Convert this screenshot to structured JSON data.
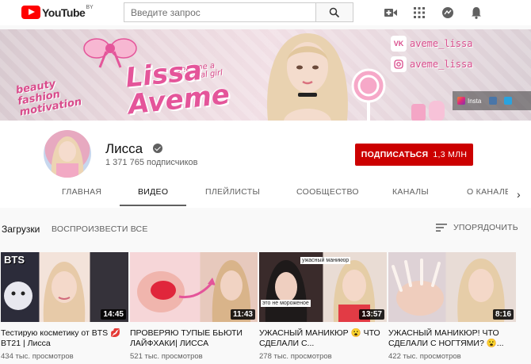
{
  "header": {
    "logo_word": "YouTube",
    "region": "BY",
    "search_placeholder": "Введите запрос"
  },
  "banner": {
    "title_line1": "Lissa",
    "title_line2": "Aveme",
    "tagline_top_1": "Become a",
    "tagline_top_2": "magical girl",
    "tagline_left_1": "beauty",
    "tagline_left_2": "fashion",
    "tagline_left_3": "motivation",
    "vk_handle": "aveme_lissa",
    "insta_handle": "aveme_lissa",
    "link_insta": "Insta"
  },
  "channel": {
    "name": "Лисса",
    "subscribers": "1 371 765 подписчиков",
    "subscribe_label": "ПОДПИСАТЬСЯ",
    "subscribe_count": "1,3 МЛН",
    "tabs": [
      "ГЛАВНАЯ",
      "ВИДЕО",
      "ПЛЕЙЛИСТЫ",
      "СООБЩЕСТВО",
      "КАНАЛЫ",
      "О КАНАЛЕ"
    ]
  },
  "section": {
    "title": "Загрузки",
    "play_all": "ВОСПРОИЗВЕСТИ ВСЕ",
    "sort": "УПОРЯДОЧИТЬ"
  },
  "videos": [
    {
      "title": "Тестирую косметику от BTS 💋 BT21 | Лисса",
      "views": "434 тыс. просмотров",
      "duration": "14:45",
      "thumb_text": "BTS"
    },
    {
      "title": "ПРОВЕРЯЮ ТУПЫЕ БЬЮТИ ЛАЙФХАКИ| ЛИССА",
      "views": "521 тыс. просмотров",
      "duration": "11:43",
      "thumb_text": ""
    },
    {
      "title": "УЖАСНЫЙ МАНИКЮР 😮 ЧТО СДЕЛАЛИ С...",
      "views": "278 тыс. просмотров",
      "duration": "13:57",
      "thumb_text": "ужасный маникюр",
      "thumb_text2": "это не мороженое"
    },
    {
      "title": "УЖАСНЫЙ МАНИКЮР! ЧТО СДЕЛАЛИ С НОГТЯМИ? 😮...",
      "views": "422 тыс. просмотров",
      "duration": "8:16",
      "thumb_text": ""
    }
  ],
  "colors": {
    "subscribe": "#cc0000",
    "accent_pink": "#e4559a"
  }
}
